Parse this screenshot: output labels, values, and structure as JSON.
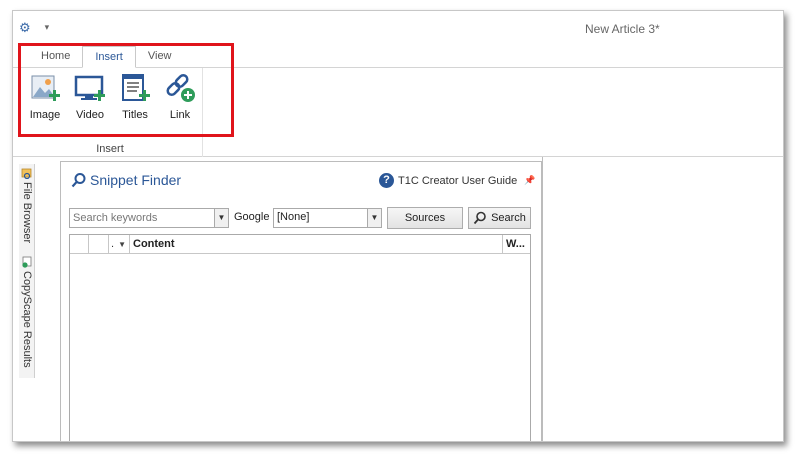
{
  "window": {
    "title": "New Article 3*"
  },
  "quick_access": {
    "gear_icon": "gear-icon",
    "dropdown_icon": "chevron-down-icon"
  },
  "ribbon": {
    "tabs": [
      {
        "label": "Home",
        "active": false
      },
      {
        "label": "Insert",
        "active": true
      },
      {
        "label": "View",
        "active": false
      }
    ],
    "group": {
      "label": "Insert",
      "buttons": [
        {
          "label": "Image",
          "icon": "image-add-icon"
        },
        {
          "label": "Video",
          "icon": "video-add-icon"
        },
        {
          "label": "Titles",
          "icon": "titles-add-icon"
        },
        {
          "label": "Link",
          "icon": "link-add-icon"
        }
      ]
    }
  },
  "side_tabs": [
    {
      "label": "File Browser",
      "icon": "file-browser-icon"
    },
    {
      "label": "CopyScape Results",
      "icon": "copyscape-icon"
    }
  ],
  "snippet_finder": {
    "title": "Snippet Finder",
    "guide_link": "T1C Creator User Guide",
    "search": {
      "placeholder": "Search keywords",
      "engine_label": "Google",
      "engine_value": "[None]",
      "sources_label": "Sources",
      "search_label": "Search"
    },
    "grid": {
      "columns": [
        {
          "label": ""
        },
        {
          "label": ""
        },
        {
          "label": "."
        },
        {
          "label": "Content"
        },
        {
          "label": "W..."
        }
      ]
    }
  },
  "colors": {
    "accent": "#2b5797",
    "highlight": "#e0141b",
    "icon_green": "#2e9c5a"
  }
}
